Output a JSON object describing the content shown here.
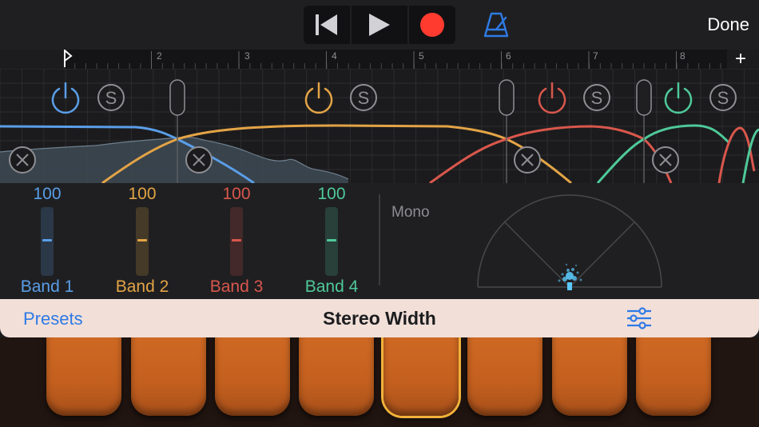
{
  "header": {
    "done_label": "Done",
    "rewind_icon": "rewind-icon",
    "play_icon": "play-icon",
    "record_icon": "record-icon",
    "metronome_icon": "metronome-icon",
    "record_color": "#ff3b30",
    "accent_color": "#2f7ae5"
  },
  "ruler": {
    "marks": [
      "2",
      "3",
      "4",
      "5",
      "6",
      "7",
      "8"
    ],
    "add_label": "+"
  },
  "eq": {
    "power_icon": "power-icon",
    "solo_label": "S",
    "remove_icon": "remove-icon"
  },
  "bands": [
    {
      "label": "Band 1",
      "value": "100",
      "color": "#5a9ee8"
    },
    {
      "label": "Band 2",
      "value": "100",
      "color": "#e3a446"
    },
    {
      "label": "Band 3",
      "value": "100",
      "color": "#d9574c"
    },
    {
      "label": "Band 4",
      "value": "100",
      "color": "#4fc99a"
    }
  ],
  "meter": {
    "mono_label": "Mono"
  },
  "footer": {
    "presets_label": "Presets",
    "title": "Stereo Width",
    "settings_icon": "sliders-icon"
  }
}
